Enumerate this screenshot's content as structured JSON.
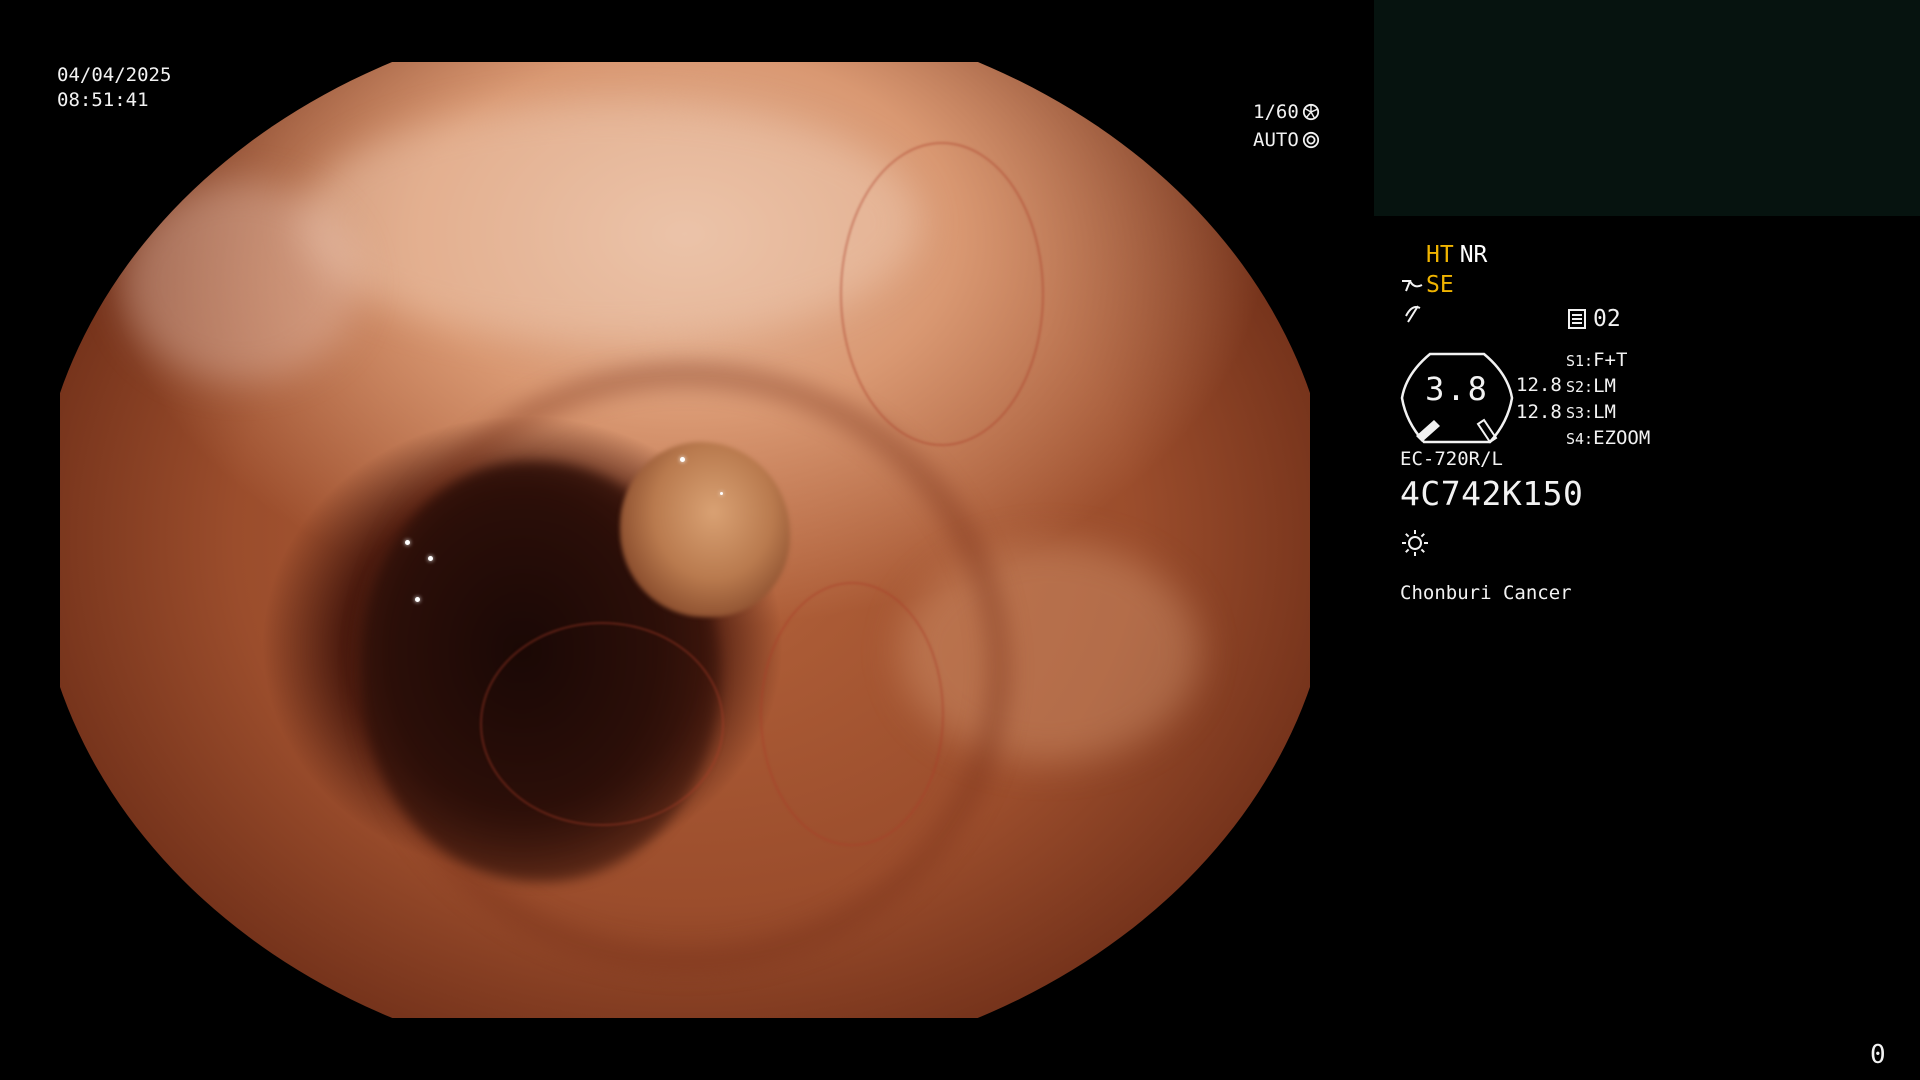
{
  "image": {
    "date": "04/04/2025",
    "time": "08:51:41"
  },
  "exposure": {
    "shutter": "1/60",
    "shutter_icon": "shutter-icon",
    "iris_mode": "AUTO",
    "iris_icon": "iris-icon"
  },
  "processing": {
    "mode_ht": "HT",
    "mode_nr": "NR",
    "mode_se": "SE",
    "se_icon": "structure-enhance-icon",
    "color_icon": "color-tone-icon",
    "preset_icon": "preset-icon",
    "preset": "02",
    "colors": {
      "active_mode": "#f0b400",
      "text": "#f2f2f2"
    }
  },
  "gauge": {
    "value": "3.8",
    "readout_top": "12.8",
    "readout_bottom": "12.8"
  },
  "switches": [
    {
      "key": "S1:",
      "value": "F+T"
    },
    {
      "key": "S2:",
      "value": "LM"
    },
    {
      "key": "S3:",
      "value": "LM"
    },
    {
      "key": "S4:",
      "value": "EZOOM"
    }
  ],
  "scope": {
    "model": "EC-720R/L",
    "serial": "4C742K150"
  },
  "light_icon": "light-source-icon",
  "institution": "Chonburi Cancer",
  "frame_counter": "0"
}
